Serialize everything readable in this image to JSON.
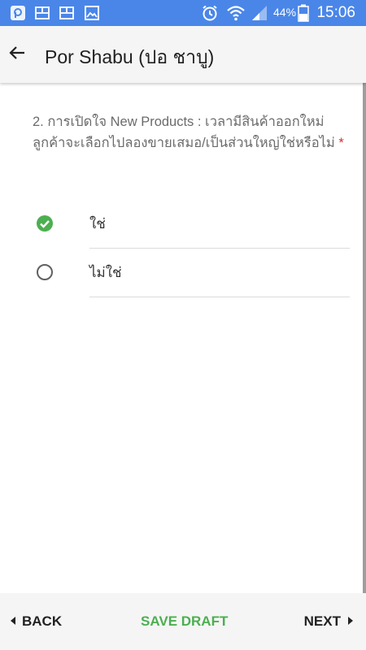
{
  "statusbar": {
    "battery_percent": "44%",
    "time": "15:06",
    "icons": [
      "app-icon",
      "image-notification-icon",
      "image-notification-icon",
      "gallery-icon",
      "alarm-icon",
      "wifi-icon",
      "signal-icon",
      "battery-icon"
    ]
  },
  "appbar": {
    "title": "Por Shabu (ปอ ชาบู)",
    "back_icon": "arrow-left-icon"
  },
  "question": {
    "text": "2. การเปิดใจ New Products : เวลามีสินค้าออกใหม่ลูกค้าจะเลือกไปลองขายเสมอ/เป็นส่วนใหญ่ใช่หรือไม่",
    "required_mark": "*"
  },
  "options": [
    {
      "label": "ใช่",
      "selected": true
    },
    {
      "label": "ไม่ใช่",
      "selected": false
    }
  ],
  "footer": {
    "back_label": "BACK",
    "save_label": "SAVE DRAFT",
    "next_label": "NEXT"
  },
  "colors": {
    "status_bar": "#4a86e8",
    "accent_green": "#4caf50",
    "required_red": "#d32f2f"
  }
}
